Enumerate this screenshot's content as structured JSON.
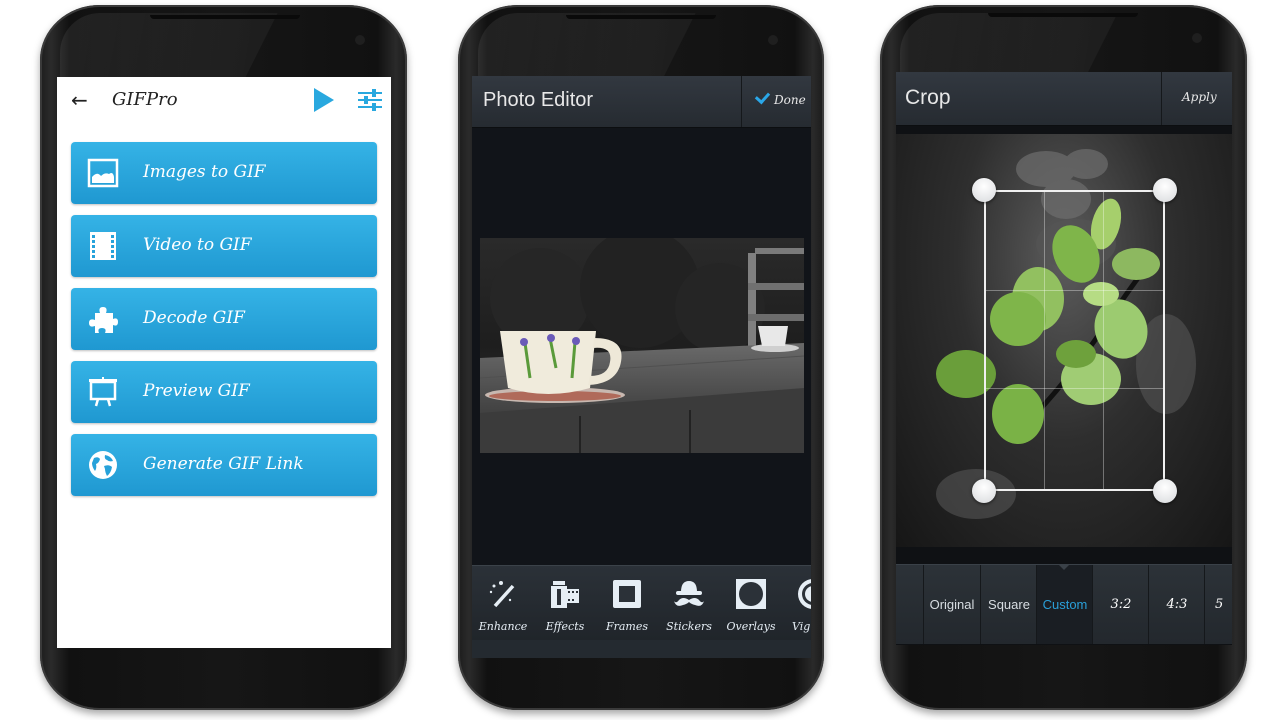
{
  "screens": [
    {
      "app_title": "GIFPro",
      "back_icon": "arrow-left-icon",
      "actions": [
        {
          "icon": "play-store-icon"
        },
        {
          "icon": "settings-sliders-icon"
        }
      ],
      "menu": [
        {
          "label": "Images to GIF",
          "icon": "image-icon"
        },
        {
          "label": "Video to GIF",
          "icon": "film-icon"
        },
        {
          "label": "Decode GIF",
          "icon": "puzzle-icon"
        },
        {
          "label": "Preview GIF",
          "icon": "presentation-icon"
        },
        {
          "label": "Generate GIF Link",
          "icon": "globe-icon"
        }
      ],
      "accent": "#29a8df"
    },
    {
      "title": "Photo Editor",
      "done_label": "Done",
      "done_icon": "checkmark-icon",
      "photo": "teacup on wooden table",
      "tools": [
        {
          "label": "Enhance",
          "icon": "magic-wand-icon"
        },
        {
          "label": "Effects",
          "icon": "film-roll-icon"
        },
        {
          "label": "Frames",
          "icon": "frame-icon"
        },
        {
          "label": "Stickers",
          "icon": "mustache-hat-icon"
        },
        {
          "label": "Overlays",
          "icon": "overlay-circle-icon"
        },
        {
          "label": "Vign",
          "icon": "vignette-icon"
        }
      ],
      "accent": "#2aa7e8"
    },
    {
      "title": "Crop",
      "apply_label": "Apply",
      "photo": "green leaves on branch",
      "ratios": [
        {
          "label": ""
        },
        {
          "label": "Original"
        },
        {
          "label": "Square"
        },
        {
          "label": "Custom",
          "selected": true
        },
        {
          "label": "3:2"
        },
        {
          "label": "4:3"
        },
        {
          "label": "5"
        }
      ],
      "accent": "#2a9fd8"
    }
  ]
}
